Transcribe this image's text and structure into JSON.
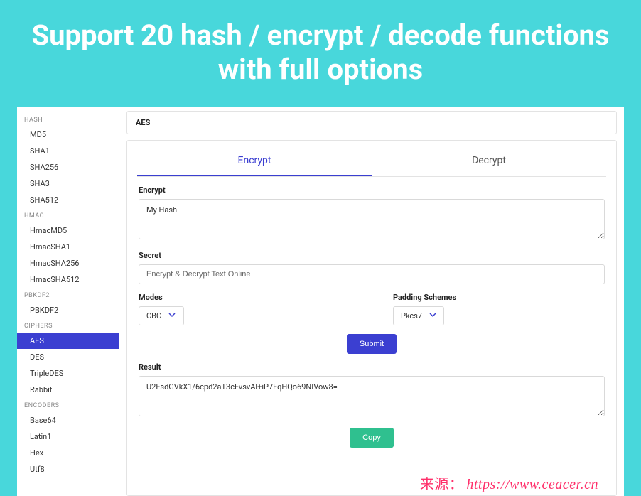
{
  "banner": {
    "title": "Support 20 hash / encrypt / decode functions with full options"
  },
  "sidebar": {
    "sections": [
      {
        "label": "HASH",
        "items": [
          {
            "label": "MD5"
          },
          {
            "label": "SHA1"
          },
          {
            "label": "SHA256"
          },
          {
            "label": "SHA3"
          },
          {
            "label": "SHA512"
          }
        ]
      },
      {
        "label": "HMAC",
        "items": [
          {
            "label": "HmacMD5"
          },
          {
            "label": "HmacSHA1"
          },
          {
            "label": "HmacSHA256"
          },
          {
            "label": "HmacSHA512"
          }
        ]
      },
      {
        "label": "PBKDF2",
        "items": [
          {
            "label": "PBKDF2"
          }
        ]
      },
      {
        "label": "CIPHERS",
        "items": [
          {
            "label": "AES",
            "active": true
          },
          {
            "label": "DES"
          },
          {
            "label": "TripleDES"
          },
          {
            "label": "Rabbit"
          }
        ]
      },
      {
        "label": "ENCODERS",
        "items": [
          {
            "label": "Base64"
          },
          {
            "label": "Latin1"
          },
          {
            "label": "Hex"
          },
          {
            "label": "Utf8"
          }
        ]
      }
    ]
  },
  "main": {
    "title": "AES",
    "tabs": [
      {
        "label": "Encrypt",
        "active": true
      },
      {
        "label": "Decrypt",
        "active": false
      }
    ],
    "encrypt": {
      "label": "Encrypt",
      "value": "My Hash"
    },
    "secret": {
      "label": "Secret",
      "value": "Encrypt & Decrypt Text Online"
    },
    "modes": {
      "label": "Modes",
      "selected": "CBC"
    },
    "padding": {
      "label": "Padding Schemes",
      "selected": "Pkcs7"
    },
    "submit_label": "Submit",
    "result": {
      "label": "Result",
      "value": "U2FsdGVkX1/6cpd2aT3cFvsvAl+iP7FqHQo69NIVow8="
    },
    "copy_label": "Copy"
  },
  "watermark": {
    "label": "来源：",
    "url": "https://www.ceacer.cn"
  }
}
